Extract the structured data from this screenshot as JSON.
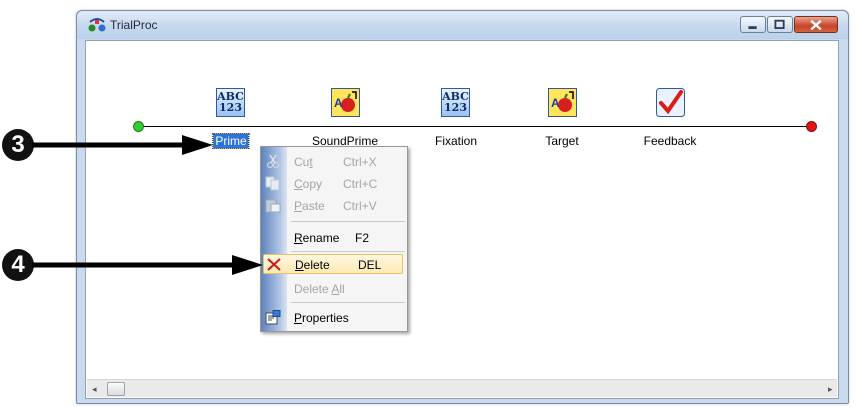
{
  "window": {
    "title": "TrialProc",
    "app_icon": "procedure-icon",
    "controls": [
      "minimize-icon",
      "maximize-icon",
      "close-icon"
    ]
  },
  "timeline": {
    "nodes": [
      {
        "label": "Prime",
        "icon": "abc-123-icon",
        "selected": true
      },
      {
        "label": "SoundPrime",
        "icon": "slide-apple-icon"
      },
      {
        "label": "Fixation",
        "icon": "abc-123-icon"
      },
      {
        "label": "Target",
        "icon": "slide-apple-icon"
      },
      {
        "label": "Feedback",
        "icon": "red-checkmark-icon"
      }
    ],
    "start_color": "#33cc33",
    "end_color": "#e31313"
  },
  "context_menu": {
    "items": [
      {
        "label_pre": "Cu",
        "label_ul": "t",
        "label_post": "",
        "shortcut": "Ctrl+X",
        "icon": "scissors-icon",
        "enabled": false
      },
      {
        "label_pre": "",
        "label_ul": "C",
        "label_post": "opy",
        "shortcut": "Ctrl+C",
        "icon": "copy-icon",
        "enabled": false
      },
      {
        "label_pre": "",
        "label_ul": "P",
        "label_post": "aste",
        "shortcut": "Ctrl+V",
        "icon": "paste-icon",
        "enabled": false
      },
      {
        "label_pre": "",
        "label_ul": "R",
        "label_post": "ename",
        "shortcut": "F2",
        "icon": "",
        "enabled": true
      },
      {
        "label_pre": "",
        "label_ul": "D",
        "label_post": "elete",
        "shortcut": "DEL",
        "icon": "red-x-icon",
        "enabled": true,
        "highlighted": true
      },
      {
        "label_pre": "Delete ",
        "label_ul": "A",
        "label_post": "ll",
        "shortcut": "",
        "icon": "",
        "enabled": false
      },
      {
        "label_pre": "",
        "label_ul": "P",
        "label_post": "roperties",
        "shortcut": "",
        "icon": "properties-icon",
        "enabled": true
      }
    ]
  },
  "callouts": [
    {
      "number": "3",
      "points_to": "Prime"
    },
    {
      "number": "4",
      "points_to": "Delete"
    }
  ],
  "scrollbar": {
    "left_arrow": "◂",
    "right_arrow": "▸"
  }
}
